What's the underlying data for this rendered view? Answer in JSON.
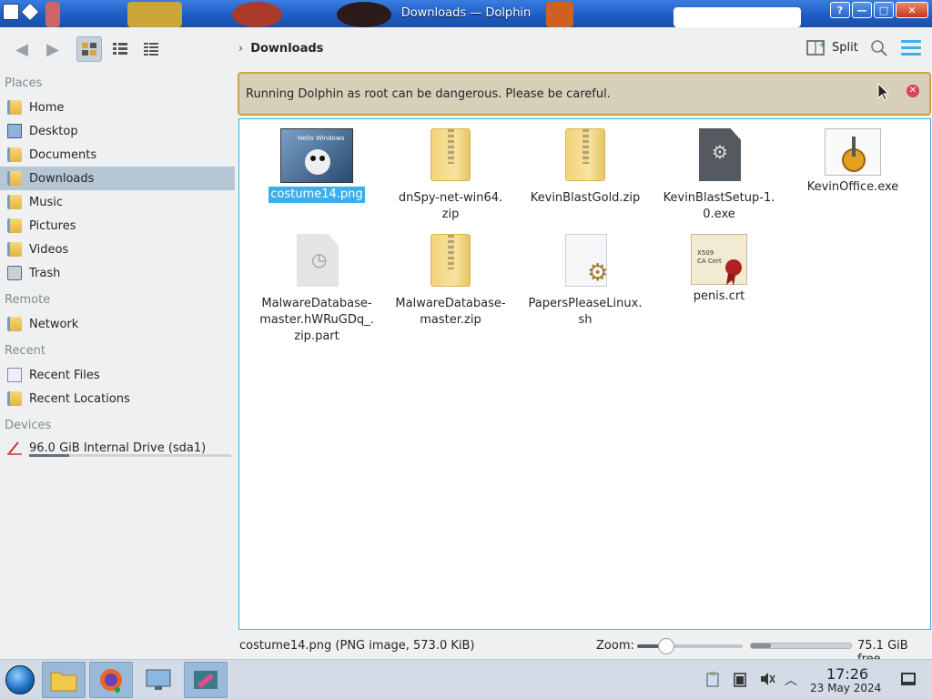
{
  "window": {
    "title": "Downloads — Dolphin"
  },
  "titlebar_buttons": {
    "help": "?",
    "minimize": "—",
    "maximize": "□",
    "close": "✕"
  },
  "breadcrumb": {
    "current": "Downloads"
  },
  "toolbar": {
    "split_label": "Split"
  },
  "sidebar": {
    "places_heading": "Places",
    "places": [
      "Home",
      "Desktop",
      "Documents",
      "Downloads",
      "Music",
      "Pictures",
      "Videos",
      "Trash"
    ],
    "remote_heading": "Remote",
    "remote": [
      "Network"
    ],
    "recent_heading": "Recent",
    "recent": [
      "Recent Files",
      "Recent Locations"
    ],
    "devices_heading": "Devices",
    "devices": [
      "96.0 GiB Internal Drive (sda1)"
    ],
    "drive_usage_fraction": 0.2
  },
  "banner": {
    "message": "Running Dolphin as root can be dangerous. Please be careful."
  },
  "files": [
    {
      "name": "costume14.png",
      "type": "image",
      "selected": true
    },
    {
      "name": "dnSpy-net-win64.zip",
      "type": "zip"
    },
    {
      "name": "KevinBlastGold.zip",
      "type": "zip"
    },
    {
      "name": "KevinBlastSetup-1.0.exe",
      "type": "exe"
    },
    {
      "name": "KevinOffice.exe",
      "type": "exe-installer"
    },
    {
      "name": "MalwareDatabase-master.hWRuGDq_.zip.part",
      "type": "partial"
    },
    {
      "name": "MalwareDatabase-master.zip",
      "type": "zip"
    },
    {
      "name": "PapersPleaseLinux.sh",
      "type": "script"
    },
    {
      "name": "penis.crt",
      "type": "certificate"
    }
  ],
  "statusbar": {
    "selection_info": "costume14.png (PNG image, 573.0 KiB)",
    "zoom_label": "Zoom:",
    "zoom_fraction": 0.28,
    "free_space": "75.1 GiB free",
    "used_fraction": 0.2
  },
  "taskbar": {
    "apps": [
      "file-manager-icon",
      "firefox-icon",
      "system-settings-icon",
      "krita-icon"
    ],
    "time": "17:26",
    "date": "23 May 2024"
  },
  "colors": {
    "accent": "#3daee9",
    "banner_bg": "#d8cfb8",
    "banner_border": "#c9a44a",
    "titlebar": "#1d5bc4"
  }
}
